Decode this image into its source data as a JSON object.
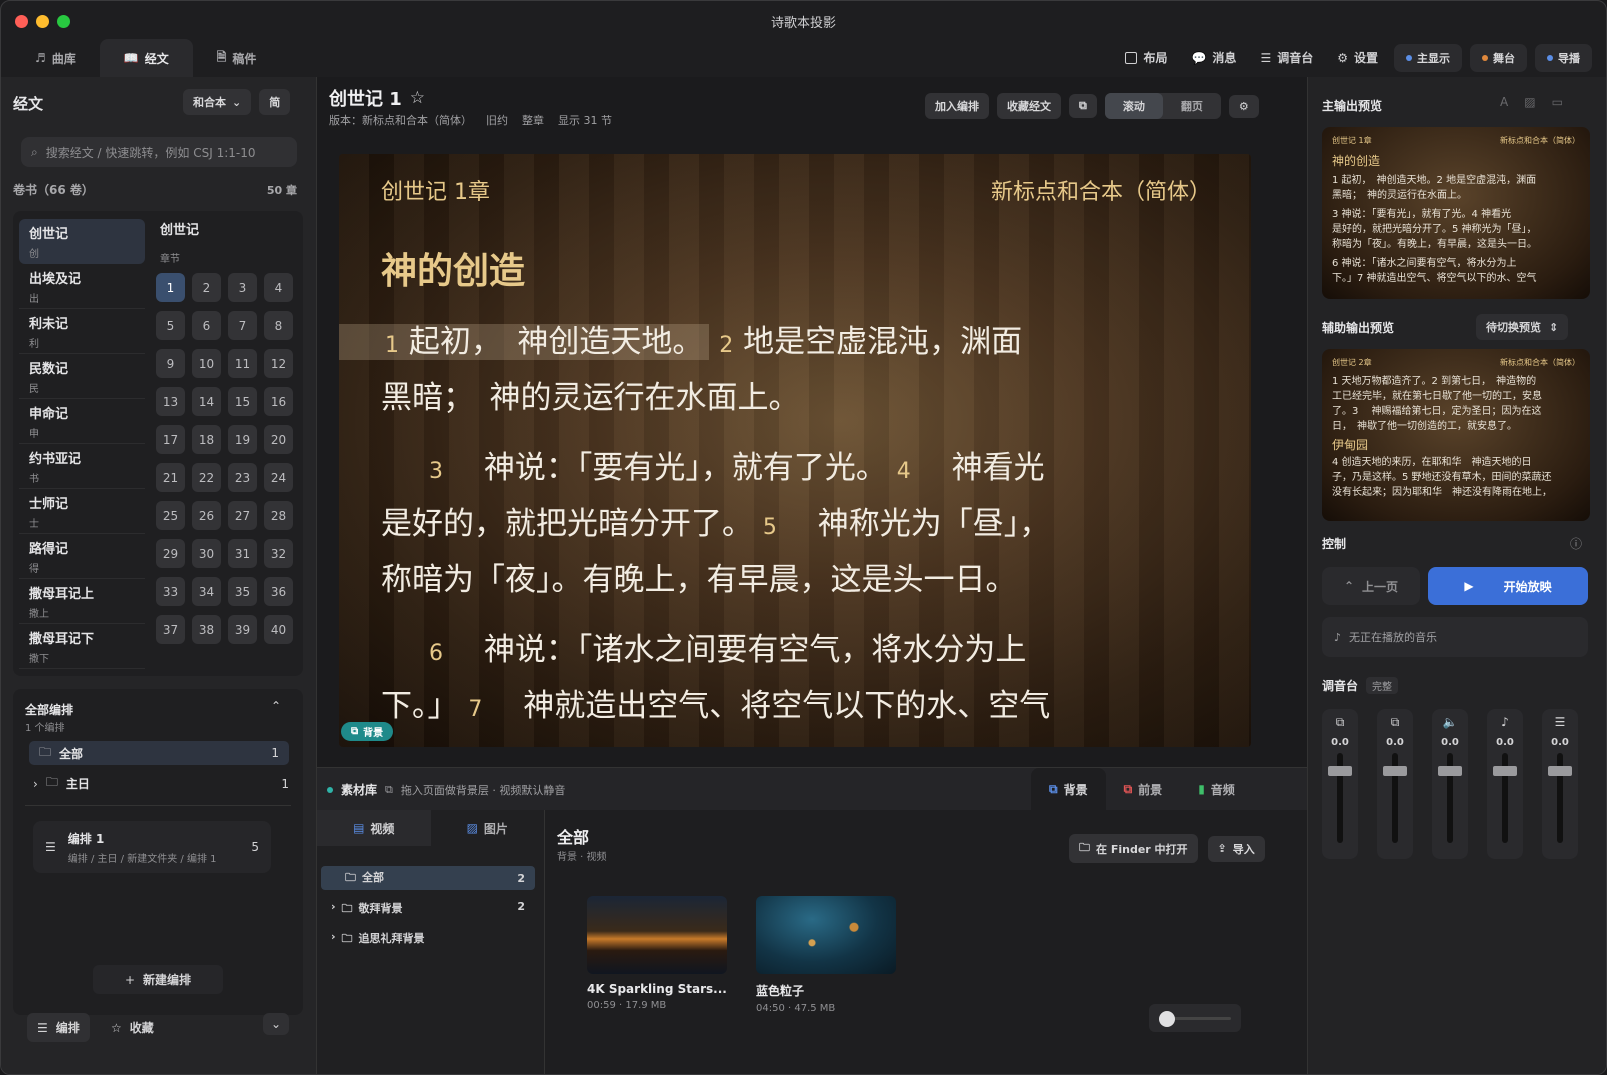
{
  "app": {
    "title": "诗歌本投影"
  },
  "tabs": [
    {
      "label": "曲库"
    },
    {
      "label": "经文"
    },
    {
      "label": "稿件"
    }
  ],
  "toolbar": {
    "layout": "布局",
    "message": "消息",
    "mixer": "调音台",
    "settings": "设置",
    "main_display": "主显示",
    "stage": "舞台",
    "director": "导播"
  },
  "colors": {
    "accent": "#3a4f6e",
    "gold": "#e7c98a",
    "play": "#3b6fd8"
  },
  "sidebar": {
    "title": "经文",
    "version": "和合本",
    "simplified": "简",
    "search_placeholder": "搜索经文 / 快速跳转，例如 CSJ 1:1-10",
    "books_header": "卷书（66 卷）",
    "chapters_count": "50 章",
    "books": [
      {
        "name": "创世记",
        "abbr": "创"
      },
      {
        "name": "出埃及记",
        "abbr": "出"
      },
      {
        "name": "利未记",
        "abbr": "利"
      },
      {
        "name": "民数记",
        "abbr": "民"
      },
      {
        "name": "申命记",
        "abbr": "申"
      },
      {
        "name": "约书亚记",
        "abbr": "书"
      },
      {
        "name": "士师记",
        "abbr": "士"
      },
      {
        "name": "路得记",
        "abbr": "得"
      },
      {
        "name": "撒母耳记上",
        "abbr": "撒上"
      },
      {
        "name": "撒母耳记下",
        "abbr": "撒下"
      }
    ],
    "chapter_book": "创世记",
    "chapter_label": "章节",
    "chapters": [
      "1",
      "2",
      "3",
      "4",
      "5",
      "6",
      "7",
      "8",
      "9",
      "10",
      "11",
      "12",
      "13",
      "14",
      "15",
      "16",
      "17",
      "18",
      "19",
      "20",
      "21",
      "22",
      "23",
      "24",
      "25",
      "26",
      "27",
      "28",
      "29",
      "30",
      "31",
      "32",
      "33",
      "34",
      "35",
      "36",
      "37",
      "38",
      "39",
      "40"
    ],
    "arrangements": {
      "title": "全部编排",
      "count": "1 个编排",
      "all": "全部",
      "all_count": "1",
      "sunday": "主日",
      "sunday_count": "1",
      "item_title": "编排 1",
      "item_path": "编排 / 主日 / 新建文件夹 / 编排 1",
      "item_count": "5",
      "new": "新建编排"
    },
    "bottom": {
      "arrange": "编排",
      "favorites": "收藏"
    }
  },
  "passage": {
    "title": "创世记 1",
    "meta_version": "版本：新标点和合本（简体）",
    "meta_testament": "旧约",
    "meta_scope": "整章",
    "meta_count": "显示 31 节",
    "add_arrange": "加入编排",
    "fav_verse": "收藏经文",
    "scroll": "滚动",
    "page": "翻页"
  },
  "stage": {
    "chapter": "创世记 1章",
    "version": "新标点和合本（简体）",
    "heading": "神的创造",
    "v1n": "1",
    "v1": "起初，　神创造天地。",
    "v2n": "2",
    "v2": "地是空虚混沌，渊面",
    "v2b": "黑暗；　神的灵运行在水面上。",
    "v3n": "3",
    "v3": "神说：「要有光」，就有了光。",
    "v4n": "4",
    "v4": "神看光",
    "v4b": "是好的，就把光暗分开了。",
    "v5n": "5",
    "v5": "神称光为「昼」，",
    "v5b": "称暗为「夜」。有晚上，有早晨，这是头一日。",
    "v6n": "6",
    "v6": "神说：「诸水之间要有空气，将水分为上",
    "v6b": "下。」",
    "v7n": "7",
    "v7": "神就造出空气、将空气以下的水、空气",
    "bg_badge": "背景"
  },
  "library": {
    "title": "素材库",
    "hint": "拖入页面做背景层 · 视频默认静音",
    "tab_bg": "背景",
    "tab_fg": "前景",
    "tab_audio": "音频",
    "video": "视频",
    "image": "图片",
    "folder_all": "全部",
    "folder_all_count": "2",
    "folder_worship": "敬拜背景",
    "folder_worship_count": "2",
    "folder_memorial": "追思礼拜背景",
    "main_title": "全部",
    "main_sub": "背景 · 视频",
    "finder": "在 Finder 中打开",
    "import": "导入",
    "items": [
      {
        "name": "4K Sparkling Stars...",
        "meta": "00:59 · 17.9 MB"
      },
      {
        "name": "蓝色粒子",
        "meta": "04:50 · 47.5 MB"
      }
    ]
  },
  "right": {
    "main_preview": "主输出预览",
    "aux_preview": "辅助输出预览",
    "aux_select": "待切换预览",
    "mp_left": "创世记 1章",
    "mp_right": "新标点和合本（简体）",
    "mp_heading": "神的创造",
    "mp_l1": "1 起初，　神创造天地。2 地是空虚混沌，渊面",
    "mp_l2": "黑暗；　神的灵运行在水面上。",
    "mp_l3": "3 神说：「要有光」，就有了光。4 神看光",
    "mp_l4": "是好的，就把光暗分开了。5 神称光为「昼」，",
    "mp_l5": "称暗为「夜」。有晚上，有早晨，这是头一日。",
    "mp_l6": "6 神说：「诸水之间要有空气，将水分为上",
    "mp_l7": "下。」7 神就造出空气、将空气以下的水、空气",
    "ap_left": "创世记 2章",
    "ap_right": "新标点和合本（简体）",
    "ap_l1": "1 天地万物都造齐了。2 到第七日，　神造物的",
    "ap_l2": "工已经完毕，就在第七日歇了他一切的工，安息",
    "ap_l3": "了。3 　神赐福给第七日，定为圣日；因为在这",
    "ap_l4": "日，　神歇了他一切创造的工，就安息了。",
    "ap_heading": "伊甸园",
    "ap_l5": "4 创造天地的来历，在耶和华　神造天地的日",
    "ap_l6": "子，乃是这样。5 野地还没有草木，田间的菜蔬还",
    "ap_l7": "没有长起来；因为耶和华　神还没有降雨在地上，",
    "control": "控制",
    "prev": "上一页",
    "start": "开始放映",
    "music": "无正在播放的音乐",
    "mixer": "调音台",
    "mixer_badge": "完整",
    "channels": [
      {
        "value": "0.0",
        "level": 0.8
      },
      {
        "value": "0.0",
        "level": 0.8
      },
      {
        "value": "0.0",
        "level": 0.8
      },
      {
        "value": "0.0",
        "level": 0.8
      },
      {
        "value": "0.0",
        "level": 0.8
      }
    ]
  }
}
